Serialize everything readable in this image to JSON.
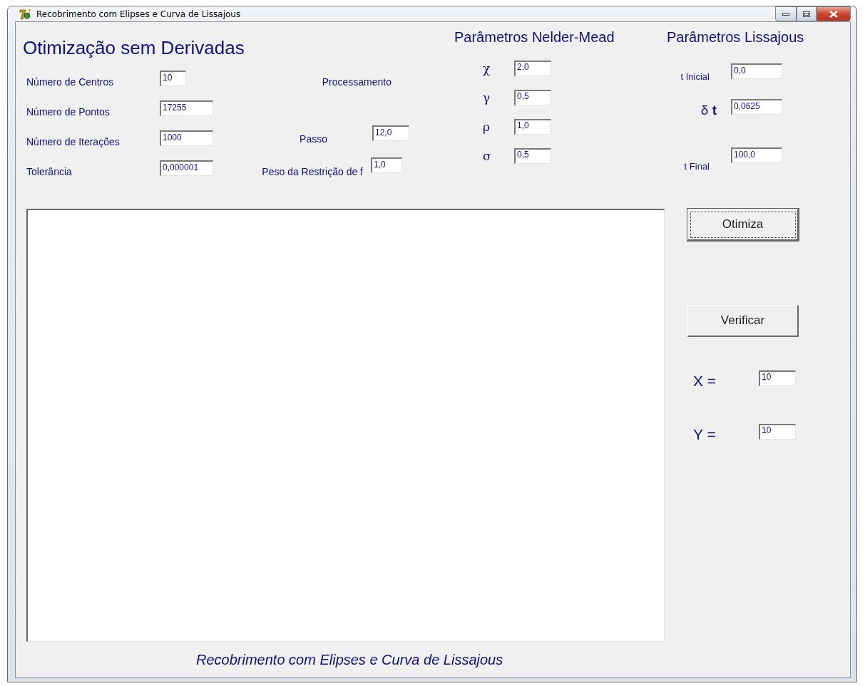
{
  "window": {
    "title": "Recobrimento com Elipses e Curva de Lissajous"
  },
  "header": {
    "title": "Otimização sem Derivadas"
  },
  "settings": [
    {
      "label": "Número de Centros",
      "value": "10",
      "kind": "short"
    },
    {
      "label": "Número de Pontos",
      "value": "17255",
      "kind": "long"
    },
    {
      "label": "Número de Iterações",
      "value": "1000",
      "kind": "long"
    },
    {
      "label": "Tolerância",
      "value": "0,000001",
      "kind": "long"
    }
  ],
  "processing": {
    "title": "Processamento",
    "fields": [
      {
        "label": "Passo",
        "value": "12,0"
      },
      {
        "label": "Peso da Restrição de f",
        "value": "1,0"
      }
    ]
  },
  "nelder_mead": {
    "title": "Parâmetros Nelder-Mead",
    "params": [
      {
        "symbol": "χ",
        "value": "2,0"
      },
      {
        "symbol": "γ",
        "value": "0,5"
      },
      {
        "symbol": "ρ",
        "value": "1,0"
      },
      {
        "symbol": "σ",
        "value": "0,5"
      }
    ]
  },
  "lissajous": {
    "title": "Parâmetros Lissajous",
    "params": [
      {
        "label": "t Inicial",
        "value": "0,0",
        "kind": "plain"
      },
      {
        "label": "δ **t**",
        "value": "0,0625",
        "kind": "large"
      },
      {
        "label": "t Final",
        "value": "100,0",
        "kind": "plain"
      }
    ]
  },
  "buttons": [
    {
      "label": "Otimiza",
      "focused": true
    },
    {
      "label": "Verificar",
      "focused": false
    }
  ],
  "coordinates": [
    {
      "label": "X =",
      "value": "10"
    },
    {
      "label": "Y =",
      "value": "10"
    }
  ],
  "footer": "Recobrimento com Elipses e Curva de Lissajous"
}
